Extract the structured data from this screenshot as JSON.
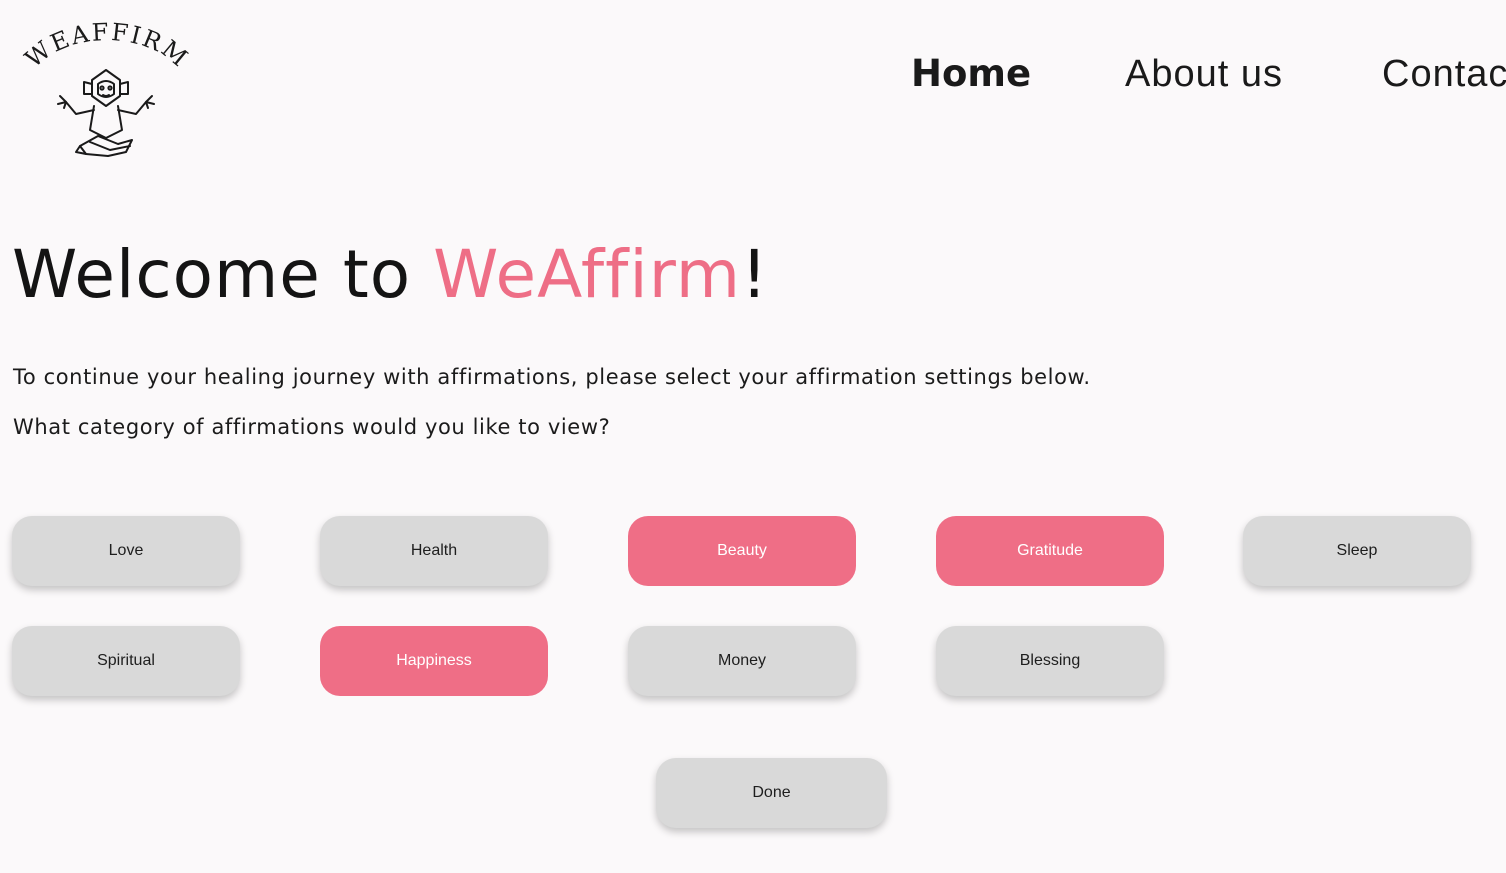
{
  "header": {
    "logo": {
      "text": "WEAFFIRM",
      "icon": "meditating-monkey-icon"
    },
    "nav": [
      {
        "label": "Home",
        "active": true
      },
      {
        "label": "About us",
        "active": false
      },
      {
        "label": "Contact",
        "active": false
      }
    ]
  },
  "main": {
    "welcome": {
      "prefix": "Welcome to ",
      "brand": "WeAffirm",
      "suffix": "!"
    },
    "intro": "To continue your healing journey with affirmations, please select your affirmation settings below.",
    "question": "What category of affirmations would you like to view?",
    "categories": [
      {
        "label": "Love",
        "selected": false
      },
      {
        "label": "Health",
        "selected": false
      },
      {
        "label": "Beauty",
        "selected": true
      },
      {
        "label": "Gratitude",
        "selected": true
      },
      {
        "label": "Sleep",
        "selected": false
      },
      {
        "label": "Spiritual",
        "selected": false
      },
      {
        "label": "Happiness",
        "selected": true
      },
      {
        "label": "Money",
        "selected": false
      },
      {
        "label": "Blessing",
        "selected": false
      }
    ],
    "done_label": "Done"
  },
  "colors": {
    "background": "#fbf9fa",
    "accent": "#ef6e86",
    "button_default": "#d9d9d9",
    "text": "#141414"
  }
}
